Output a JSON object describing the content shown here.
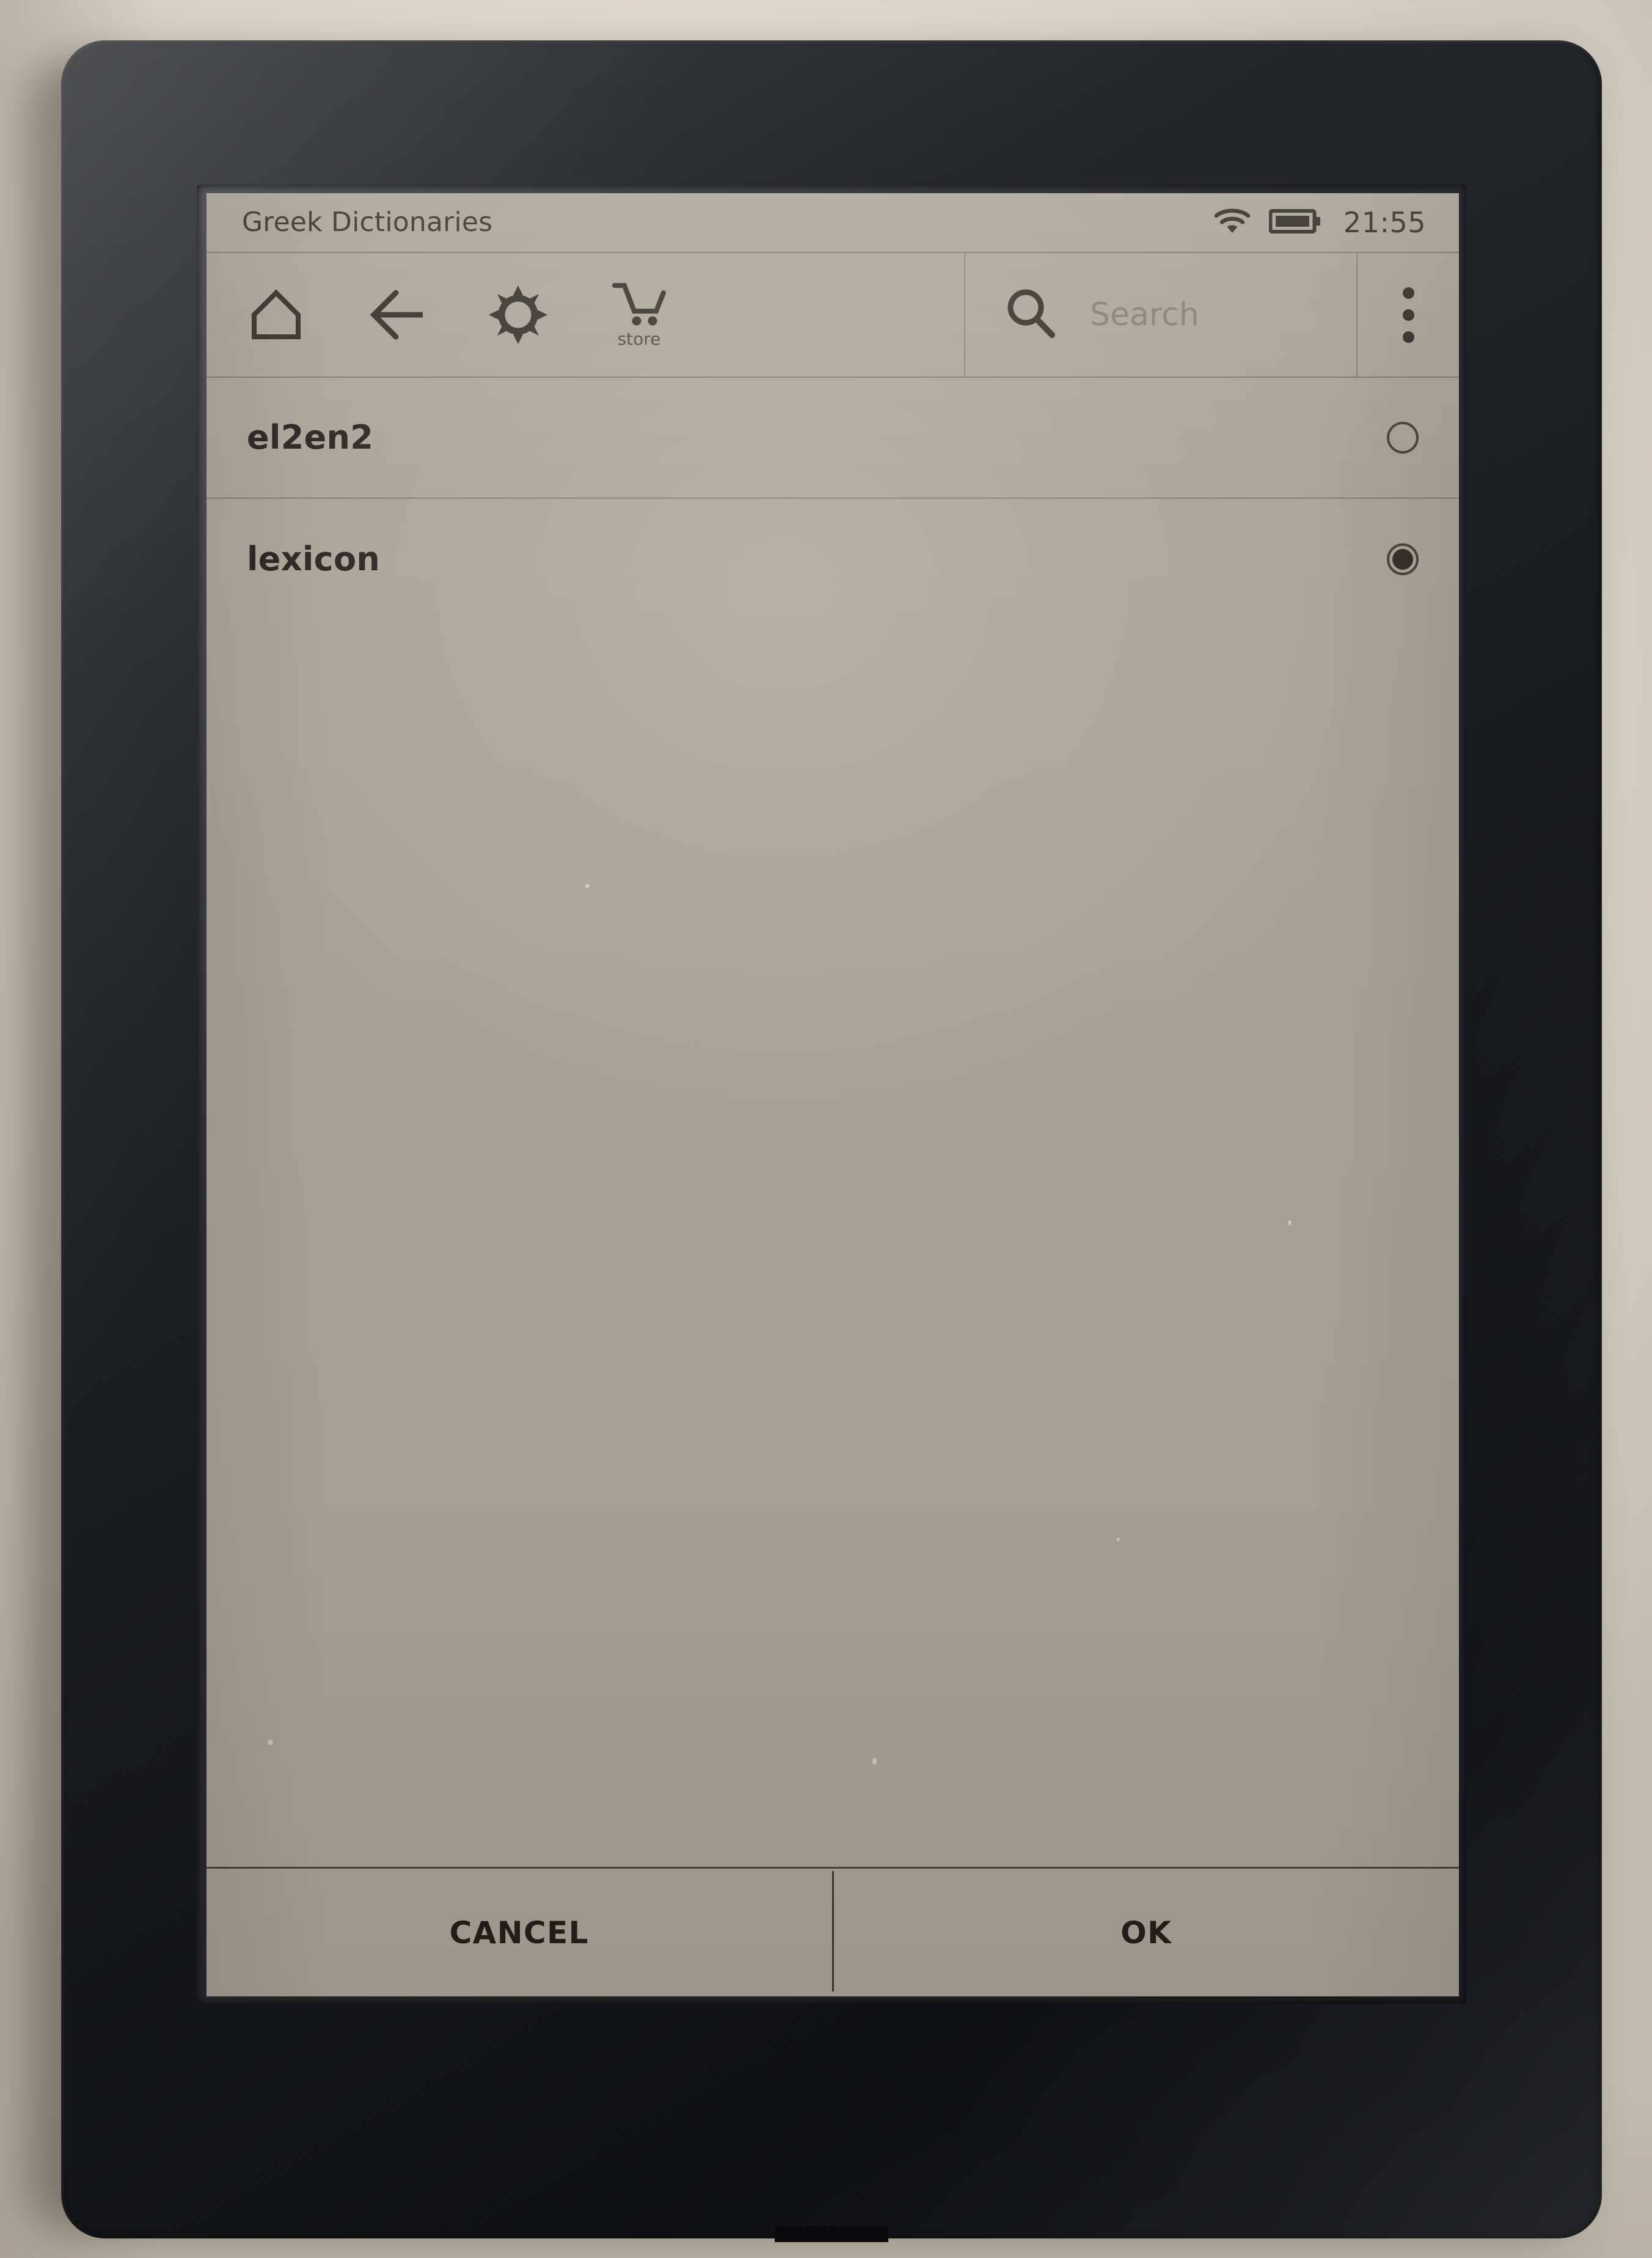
{
  "status_bar": {
    "title": "Greek Dictionaries",
    "time": "21:55",
    "wifi_icon": "wifi-icon",
    "battery_icon": "battery-icon"
  },
  "toolbar": {
    "items": [
      {
        "name": "home-button",
        "icon": "home-icon",
        "label": ""
      },
      {
        "name": "back-button",
        "icon": "back-arrow-icon",
        "label": ""
      },
      {
        "name": "settings-button",
        "icon": "gear-icon",
        "label": ""
      },
      {
        "name": "store-button",
        "icon": "shopping-cart-icon",
        "label": "store"
      }
    ],
    "store_label": "store",
    "overflow_icon": "more-vertical-icon"
  },
  "search": {
    "icon": "search-icon",
    "placeholder": "Search",
    "value": ""
  },
  "dictionary_list": {
    "items": [
      {
        "label": "el2en2",
        "selected": false
      },
      {
        "label": "lexicon",
        "selected": true
      }
    ]
  },
  "buttons": {
    "cancel_label": "CANCEL",
    "ok_label": "OK"
  },
  "colors": {
    "screen_background": "#a9a398",
    "text": "#282320",
    "placeholder_text": "#837e76",
    "divider": "#7f7a71",
    "device_body": "#17181b"
  }
}
